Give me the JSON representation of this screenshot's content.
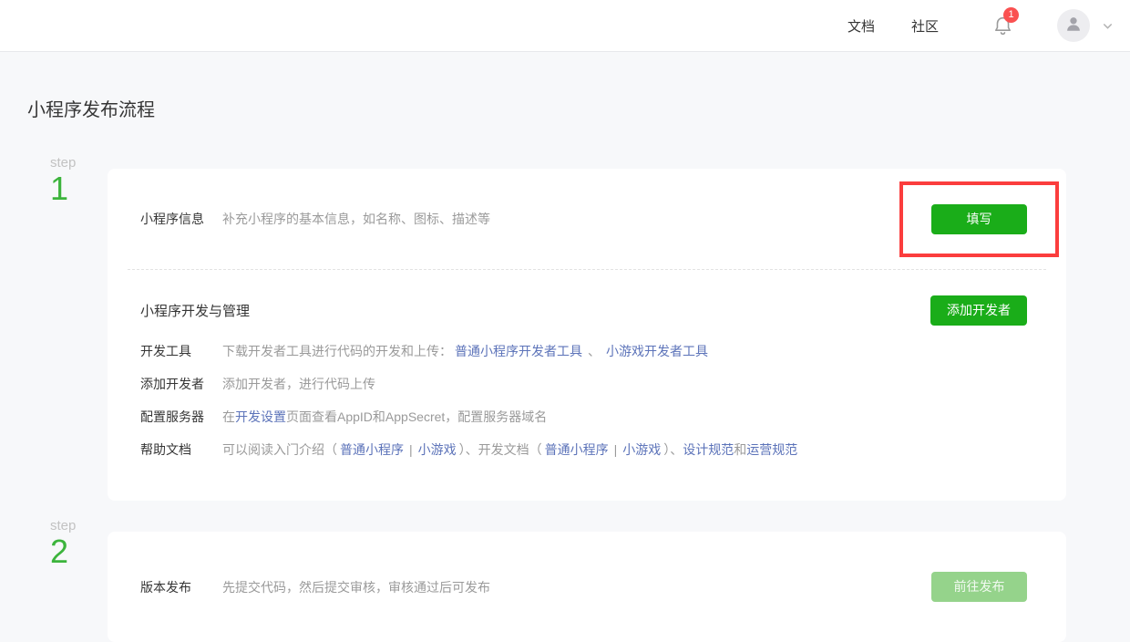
{
  "header": {
    "nav_docs": "文档",
    "nav_community": "社区",
    "notification_badge": "1"
  },
  "page_title": "小程序发布流程",
  "colors": {
    "primary_green": "#1aad19",
    "disabled_green": "#95d38b",
    "step_green": "#3cb43c",
    "link_blue": "#5c73b9",
    "highlight_red": "#fb3d3d",
    "badge_red": "#fa5151"
  },
  "icons": [
    "bell-icon",
    "user-avatar-icon",
    "chevron-down-icon"
  ],
  "step1": {
    "word": "step",
    "number": "1",
    "info_row": {
      "title": "小程序信息",
      "desc": "补充小程序的基本信息，如名称、图标、描述等",
      "button_label": "填写"
    },
    "dev_section": {
      "heading": "小程序开发与管理",
      "button_label": "添加开发者",
      "rows": {
        "tools": {
          "label": "开发工具",
          "text": "下载开发者工具进行代码的开发和上传：",
          "link1": "普通小程序开发者工具",
          "sep": "、",
          "link2": "小游戏开发者工具"
        },
        "add_dev": {
          "label": "添加开发者",
          "text": "添加开发者，进行代码上传"
        },
        "server": {
          "label": "配置服务器",
          "pre": "在",
          "link": "开发设置",
          "post": "页面查看AppID和AppSecret，配置服务器域名"
        },
        "docs": {
          "label": "帮助文档",
          "t1": "可以阅读入门介绍（",
          "l1": "普通小程序",
          "s1": "|",
          "l2": "小游戏",
          "t2": "）、开发文档（",
          "l3": "普通小程序",
          "s2": "|",
          "l4": "小游戏",
          "t3": "）、",
          "l5": "设计规范",
          "t4": "和",
          "l6": "运营规范"
        }
      }
    }
  },
  "step2": {
    "word": "step",
    "number": "2",
    "info_row": {
      "title": "版本发布",
      "desc": "先提交代码，然后提交审核，审核通过后可发布",
      "button_label": "前往发布"
    }
  }
}
